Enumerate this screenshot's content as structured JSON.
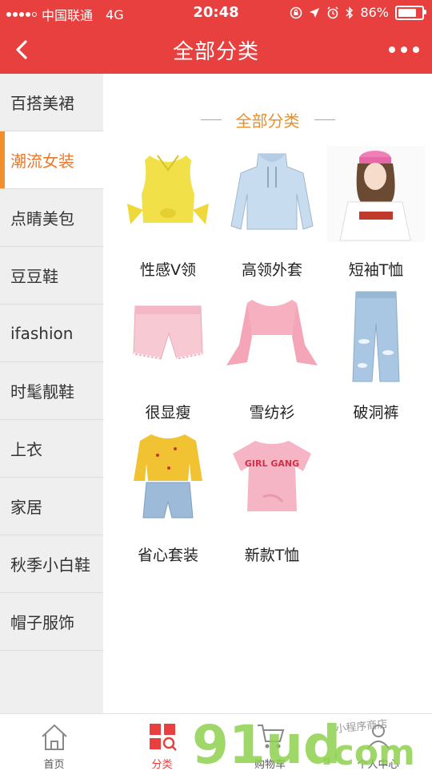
{
  "status": {
    "carrier": "中国联通",
    "network": "4G",
    "time": "20:48",
    "battery": "86%"
  },
  "header": {
    "title": "全部分类"
  },
  "sidebar": {
    "items": [
      {
        "label": "百搭美裙"
      },
      {
        "label": "潮流女装"
      },
      {
        "label": "点睛美包"
      },
      {
        "label": "豆豆鞋"
      },
      {
        "label": "ifashion"
      },
      {
        "label": "时髦靓鞋"
      },
      {
        "label": "上衣"
      },
      {
        "label": "家居"
      },
      {
        "label": "秋季小白鞋"
      },
      {
        "label": "帽子服饰"
      }
    ],
    "active_index": 1
  },
  "main": {
    "section_title": "全部分类",
    "items": [
      {
        "label": "性感V领",
        "image": "yellow-sleeveless-top"
      },
      {
        "label": "高领外套",
        "image": "light-blue-hoodie"
      },
      {
        "label": "短袖T恤",
        "image": "girl-pink-cap-tshirt"
      },
      {
        "label": "很显瘦",
        "image": "pink-denim-shorts"
      },
      {
        "label": "雪纺衫",
        "image": "pink-flare-sleeve-crop-top"
      },
      {
        "label": "破洞裤",
        "image": "ripped-jeans"
      },
      {
        "label": "省心套装",
        "image": "yellow-blouse-denim-shorts"
      },
      {
        "label": "新款T恤",
        "image": "pink-tshirt",
        "print_text": "GIRL GANG"
      }
    ]
  },
  "tabbar": {
    "items": [
      {
        "label": "首页",
        "icon": "home-icon"
      },
      {
        "label": "分类",
        "icon": "category-icon"
      },
      {
        "label": "购物车",
        "icon": "cart-icon"
      },
      {
        "label": "个人中心",
        "icon": "user-icon"
      }
    ],
    "active_index": 1
  },
  "watermark": {
    "text": "91ud.com",
    "subtext": "小程序商店"
  },
  "colors": {
    "brand_red": "#e8403e",
    "accent_orange": "#e8902e",
    "sidebar_bg": "#efefef"
  }
}
